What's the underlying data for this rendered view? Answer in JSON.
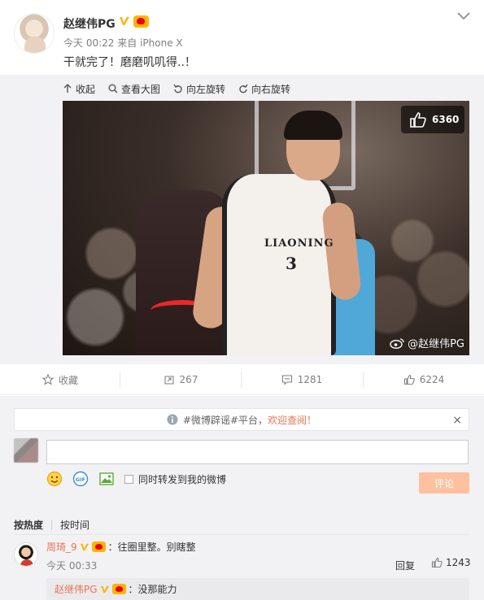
{
  "post": {
    "author": "赵继伟PG",
    "time": "今天 00:22",
    "source_prefix": "来自",
    "source": "iPhone X",
    "text": "干就完了！磨磨叽叽得..！"
  },
  "media_tools": {
    "collapse": "收起",
    "view_large": "查看大图",
    "rotate_left": "向左旋转",
    "rotate_right": "向右旋转"
  },
  "image": {
    "like_count": "6360",
    "jersey_text": "LIAONING",
    "jersey_number": "3",
    "watermark": "@赵继伟PG"
  },
  "actions": {
    "favorite": "收藏",
    "repost_count": "267",
    "comment_count": "1281",
    "like_count": "6224"
  },
  "notice": {
    "prefix": "#微博辟谣#平台，",
    "link": "欢迎查阅！",
    "close": "×"
  },
  "composer": {
    "placeholder": "",
    "repost_label": "同时转发到我的微博",
    "submit": "评论"
  },
  "sort": {
    "by_hot": "按热度",
    "by_time": "按时间"
  },
  "comments": [
    {
      "user": "周琦_9",
      "text": "：往圈里整。别瞎整",
      "time": "今天 00:33",
      "reply": "回复",
      "likes": "1243",
      "sub_reply": {
        "user": "赵继伟PG",
        "text": "：没那能力"
      }
    }
  ],
  "colors": {
    "link_orange": "#eb7350",
    "verified_gold": "#ffb400",
    "submit_disabled": "#ffc09f",
    "panel_bg": "#f2f2f5"
  }
}
